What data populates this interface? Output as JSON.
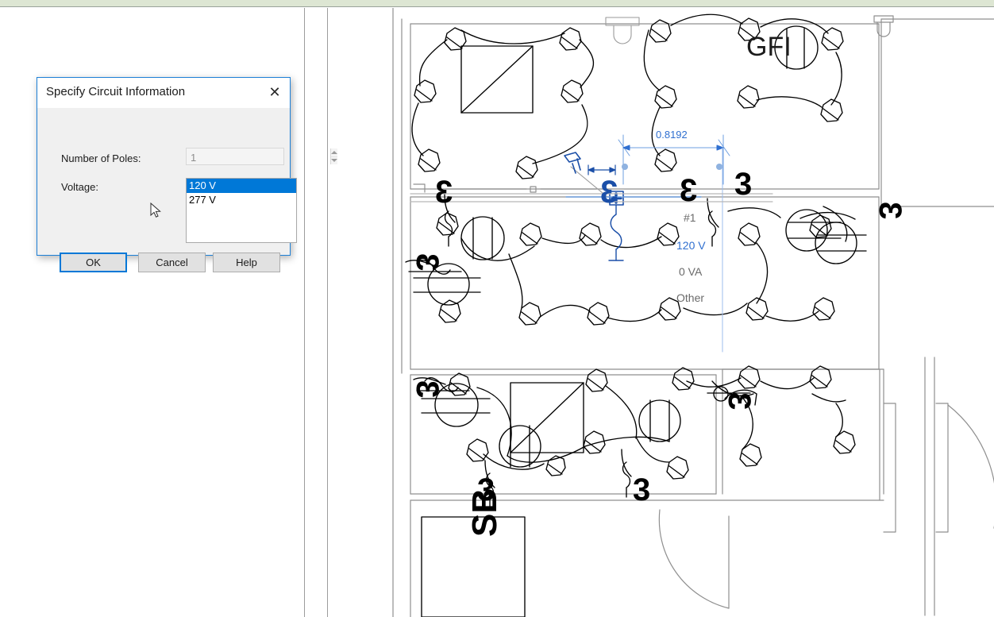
{
  "window": {
    "ribbon_strip_color": "#dde6d3"
  },
  "dialog": {
    "title": "Specify Circuit Information",
    "close_icon": "close-icon",
    "fields": {
      "poles_label": "Number of Poles:",
      "poles_value": "1",
      "voltage_label": "Voltage:"
    },
    "voltage_options": [
      {
        "label": "120 V",
        "selected": true
      },
      {
        "label": "277 V",
        "selected": false
      }
    ],
    "buttons": {
      "ok": "OK",
      "cancel": "Cancel",
      "help": "Help"
    }
  },
  "drawing": {
    "annotations": {
      "gfi": "GFI",
      "dimension": "0.8192",
      "circuit_number": "#1",
      "voltage": "120 V",
      "load": "0 VA",
      "load_classification": "Other",
      "panel_tag": "SB"
    },
    "switch_markers": [
      {
        "label": "3",
        "id": "switch-marker-top-left"
      },
      {
        "label": "3",
        "id": "switch-marker-top-center"
      },
      {
        "label": "3",
        "id": "switch-marker-top-right"
      },
      {
        "label": "3",
        "id": "switch-marker-right-upper"
      },
      {
        "label": "3",
        "id": "switch-marker-left-mid"
      },
      {
        "label": "3",
        "id": "switch-marker-left-lower"
      },
      {
        "label": "3",
        "id": "switch-marker-center-lower"
      },
      {
        "label": "3",
        "id": "switch-marker-bottom-left"
      },
      {
        "label": "3",
        "id": "switch-marker-bottom-center"
      }
    ],
    "colors": {
      "wire": "#000000",
      "wall": "#8f8f8f",
      "selection": "#1b4fa8",
      "dimension": "#2f6fd0",
      "annotation": "#6a6a6a"
    }
  }
}
